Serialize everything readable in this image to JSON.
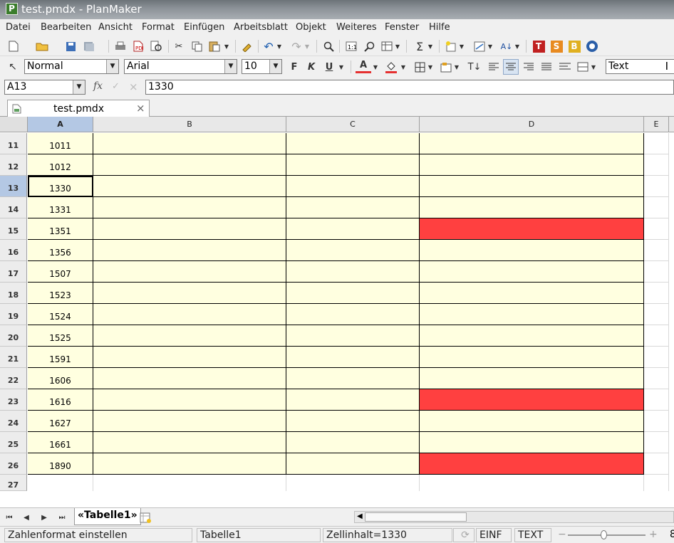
{
  "window": {
    "title": "test.pmdx - PlanMaker",
    "app_icon_letter": "P"
  },
  "menu": [
    "Datei",
    "Bearbeiten",
    "Ansicht",
    "Format",
    "Einfügen",
    "Arbeitsblatt",
    "Objekt",
    "Weiteres",
    "Fenster",
    "Hilfe"
  ],
  "format_toolbar": {
    "style": "Normal",
    "font": "Arial",
    "size": "10",
    "bold": "F",
    "italic": "K",
    "underline": "U",
    "font_color_letter": "A",
    "font_color_hex": "#e53030",
    "cell_format": "Text"
  },
  "formula_bar": {
    "cell_ref": "A13",
    "fx": "fx",
    "check": "✓",
    "cancel": "×",
    "content": "1330"
  },
  "document_tab": {
    "label": "test.pmdx",
    "close": "×"
  },
  "columns": [
    "A",
    "B",
    "C",
    "D",
    "E"
  ],
  "rows": [
    {
      "num": "11",
      "a": "1011",
      "red": false
    },
    {
      "num": "12",
      "a": "1012",
      "red": false
    },
    {
      "num": "13",
      "a": "1330",
      "red": false,
      "selected": true
    },
    {
      "num": "14",
      "a": "1331",
      "red": false
    },
    {
      "num": "15",
      "a": "1351",
      "red": true
    },
    {
      "num": "16",
      "a": "1356",
      "red": false
    },
    {
      "num": "17",
      "a": "1507",
      "red": false
    },
    {
      "num": "18",
      "a": "1523",
      "red": false
    },
    {
      "num": "19",
      "a": "1524",
      "red": false
    },
    {
      "num": "20",
      "a": "1525",
      "red": false
    },
    {
      "num": "21",
      "a": "1591",
      "red": false
    },
    {
      "num": "22",
      "a": "1606",
      "red": false
    },
    {
      "num": "23",
      "a": "1616",
      "red": true
    },
    {
      "num": "24",
      "a": "1627",
      "red": false
    },
    {
      "num": "25",
      "a": "1661",
      "red": false
    },
    {
      "num": "26",
      "a": "1890",
      "red": true
    },
    {
      "num": "27",
      "a": "",
      "red": false,
      "empty": true
    }
  ],
  "colors": {
    "fill": "#ffffe0",
    "red": "#ff4040",
    "selected_header": "#b4c8e4"
  },
  "sheet_tab": {
    "label": "«Tabelle1»"
  },
  "status": {
    "hint": "Zahlenformat einstellen",
    "sheet": "Tabelle1",
    "cell_content": "Zellinhalt=1330",
    "mode": "EINF",
    "input": "TEXT",
    "zoom_minus": "−",
    "zoom_plus": "+",
    "zoom_value": "8"
  }
}
